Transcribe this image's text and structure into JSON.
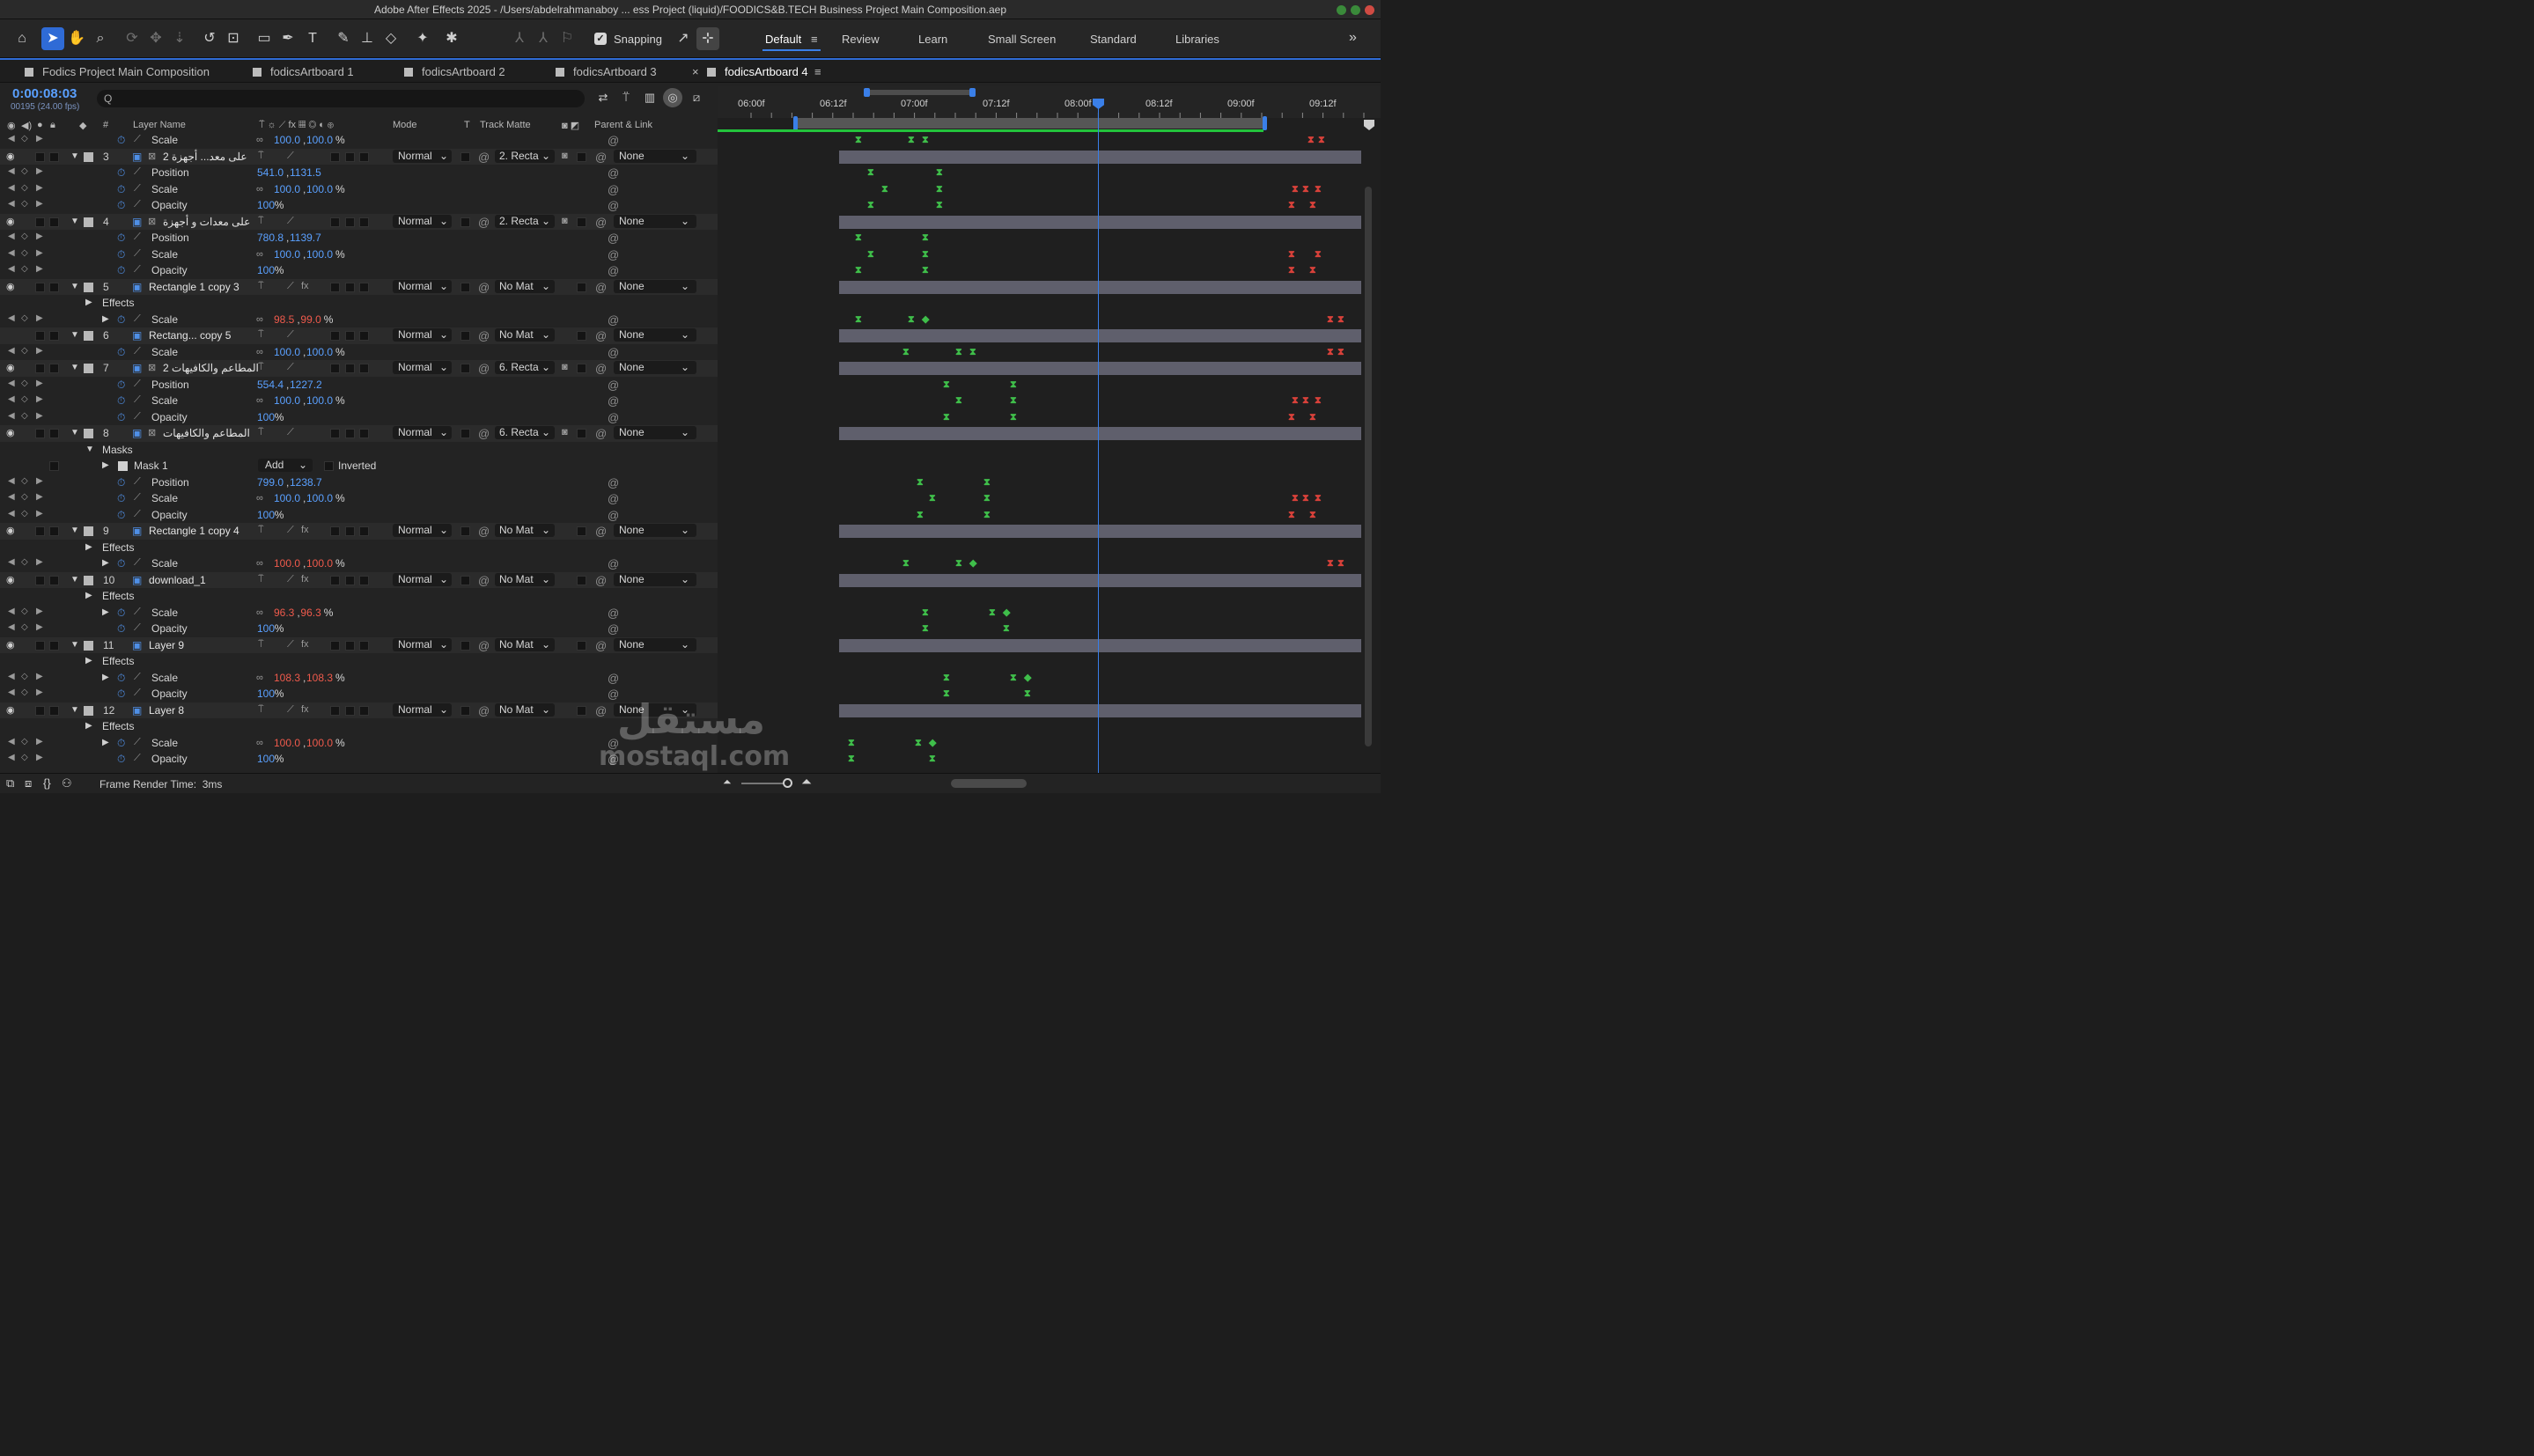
{
  "window": {
    "title": "Adobe After Effects 2025 - /Users/abdelrahmanaboy ... ess Project (liquid)/FOODICS&B.TECH Business Project Main Composition.aep"
  },
  "toolbar": {
    "snapping_label": "Snapping",
    "workspaces": [
      "Default",
      "Review",
      "Learn",
      "Small Screen",
      "Standard",
      "Libraries"
    ],
    "active_workspace": "Default",
    "more": "»"
  },
  "tabs": [
    {
      "label": "Fodics Project Main Composition",
      "active": false
    },
    {
      "label": "fodicsArtboard 1",
      "active": false
    },
    {
      "label": "fodicsArtboard 2",
      "active": false
    },
    {
      "label": "fodicsArtboard 3",
      "active": false
    },
    {
      "label": "fodicsArtboard 4",
      "active": true
    }
  ],
  "comp": {
    "timecode": "0:00:08:03",
    "frames_fps": "00195 (24.00 fps)",
    "search_placeholder": "Q"
  },
  "headers": {
    "num": "#",
    "layer_name": "Layer Name",
    "mode": "Mode",
    "t": "T",
    "track_matte": "Track Matte",
    "parent": "Parent & Link"
  },
  "ruler": {
    "labels": [
      "06:00f",
      "06:12f",
      "07:00f",
      "07:12f",
      "08:00f",
      "08:12f",
      "09:00f",
      "09:12f"
    ]
  },
  "rows": [
    {
      "type": "prop",
      "name": "Scale",
      "value": [
        "100.0",
        "100.0"
      ],
      "unit": "%",
      "link": true,
      "red": false,
      "kf": [
        [
          160,
          "g"
        ],
        [
          220,
          "g"
        ],
        [
          236,
          "g"
        ],
        [
          674,
          "r"
        ],
        [
          686,
          "r"
        ]
      ]
    },
    {
      "type": "layer",
      "num": "3",
      "name": "على معد... أجهزة 2",
      "mode": "Normal",
      "matte": "2. Recta",
      "parent": "None",
      "fx": false,
      "eye": true,
      "matte_icon": true
    },
    {
      "type": "prop",
      "name": "Position",
      "value": [
        "541.0",
        "1131.5"
      ],
      "unit": "",
      "link": false,
      "red": false,
      "kf": [
        [
          174,
          "g"
        ],
        [
          252,
          "g"
        ]
      ]
    },
    {
      "type": "prop",
      "name": "Scale",
      "value": [
        "100.0",
        "100.0"
      ],
      "unit": "%",
      "link": true,
      "red": false,
      "kf": [
        [
          190,
          "g"
        ],
        [
          252,
          "g"
        ],
        [
          656,
          "r"
        ],
        [
          668,
          "r"
        ],
        [
          682,
          "r"
        ]
      ]
    },
    {
      "type": "prop",
      "name": "Opacity",
      "value": [
        "100"
      ],
      "unit": "%",
      "link": false,
      "red": false,
      "kf": [
        [
          174,
          "g"
        ],
        [
          252,
          "g"
        ],
        [
          652,
          "r"
        ],
        [
          676,
          "r"
        ]
      ]
    },
    {
      "type": "layer",
      "num": "4",
      "name": "على معدات و أجهزة",
      "mode": "Normal",
      "matte": "2. Recta",
      "parent": "None",
      "fx": false,
      "eye": true,
      "matte_icon": true
    },
    {
      "type": "prop",
      "name": "Position",
      "value": [
        "780.8",
        "1139.7"
      ],
      "unit": "",
      "link": false,
      "red": false,
      "kf": [
        [
          160,
          "g"
        ],
        [
          236,
          "g"
        ]
      ]
    },
    {
      "type": "prop",
      "name": "Scale",
      "value": [
        "100.0",
        "100.0"
      ],
      "unit": "%",
      "link": true,
      "red": false,
      "kf": [
        [
          174,
          "g"
        ],
        [
          236,
          "g"
        ],
        [
          652,
          "r"
        ],
        [
          682,
          "r"
        ]
      ]
    },
    {
      "type": "prop",
      "name": "Opacity",
      "value": [
        "100"
      ],
      "unit": "%",
      "link": false,
      "red": false,
      "kf": [
        [
          160,
          "g"
        ],
        [
          236,
          "g"
        ],
        [
          652,
          "r"
        ],
        [
          676,
          "r"
        ]
      ]
    },
    {
      "type": "layer",
      "num": "5",
      "name": "Rectangle 1 copy 3",
      "mode": "Normal",
      "matte": "No Mat",
      "parent": "None",
      "fx": true,
      "eye": true,
      "matte_icon": false
    },
    {
      "type": "group",
      "name": "Effects",
      "indent": 116
    },
    {
      "type": "prop",
      "name": "Scale",
      "value": [
        "98.5",
        "99.0"
      ],
      "unit": "%",
      "link": true,
      "red": true,
      "twirl": true,
      "kf": [
        [
          160,
          "g"
        ],
        [
          220,
          "g"
        ],
        [
          236,
          "gd"
        ],
        [
          696,
          "r"
        ],
        [
          708,
          "r"
        ]
      ]
    },
    {
      "type": "layer",
      "num": "6",
      "name": "Rectang... copy 5",
      "mode": "Normal",
      "matte": "No Mat",
      "parent": "None",
      "fx": false,
      "eye": false,
      "matte_icon": false
    },
    {
      "type": "prop",
      "name": "Scale",
      "value": [
        "100.0",
        "100.0"
      ],
      "unit": "%",
      "link": true,
      "red": false,
      "kf": [
        [
          214,
          "g"
        ],
        [
          274,
          "g"
        ],
        [
          290,
          "g"
        ],
        [
          696,
          "r"
        ],
        [
          708,
          "r"
        ]
      ]
    },
    {
      "type": "layer",
      "num": "7",
      "name": "المطاعم والكافيهات 2",
      "mode": "Normal",
      "matte": "6. Recta",
      "parent": "None",
      "fx": false,
      "eye": true,
      "matte_icon": true
    },
    {
      "type": "prop",
      "name": "Position",
      "value": [
        "554.4",
        "1227.2"
      ],
      "unit": "",
      "link": false,
      "red": false,
      "kf": [
        [
          260,
          "g"
        ],
        [
          336,
          "g"
        ]
      ]
    },
    {
      "type": "prop",
      "name": "Scale",
      "value": [
        "100.0",
        "100.0"
      ],
      "unit": "%",
      "link": true,
      "red": false,
      "kf": [
        [
          274,
          "g"
        ],
        [
          336,
          "g"
        ],
        [
          656,
          "r"
        ],
        [
          668,
          "r"
        ],
        [
          682,
          "r"
        ]
      ]
    },
    {
      "type": "prop",
      "name": "Opacity",
      "value": [
        "100"
      ],
      "unit": "%",
      "link": false,
      "red": false,
      "kf": [
        [
          260,
          "g"
        ],
        [
          336,
          "g"
        ],
        [
          652,
          "r"
        ],
        [
          676,
          "r"
        ]
      ]
    },
    {
      "type": "layer",
      "num": "8",
      "name": "المطاعم والكافيهات",
      "mode": "Normal",
      "matte": "6. Recta",
      "parent": "None",
      "fx": false,
      "eye": true,
      "matte_icon": true
    },
    {
      "type": "group",
      "name": "Masks",
      "indent": 116,
      "open": true
    },
    {
      "type": "mask",
      "name": "Mask 1",
      "mode": "Add",
      "inverted": "Inverted"
    },
    {
      "type": "prop",
      "name": "Position",
      "value": [
        "799.0",
        "1238.7"
      ],
      "unit": "",
      "link": false,
      "red": false,
      "kf": [
        [
          230,
          "g"
        ],
        [
          306,
          "g"
        ]
      ]
    },
    {
      "type": "prop",
      "name": "Scale",
      "value": [
        "100.0",
        "100.0"
      ],
      "unit": "%",
      "link": true,
      "red": false,
      "kf": [
        [
          244,
          "g"
        ],
        [
          306,
          "g"
        ],
        [
          656,
          "r"
        ],
        [
          668,
          "r"
        ],
        [
          682,
          "r"
        ]
      ]
    },
    {
      "type": "prop",
      "name": "Opacity",
      "value": [
        "100"
      ],
      "unit": "%",
      "link": false,
      "red": false,
      "kf": [
        [
          230,
          "g"
        ],
        [
          306,
          "g"
        ],
        [
          652,
          "r"
        ],
        [
          676,
          "r"
        ]
      ]
    },
    {
      "type": "layer",
      "num": "9",
      "name": "Rectangle 1 copy 4",
      "mode": "Normal",
      "matte": "No Mat",
      "parent": "None",
      "fx": true,
      "eye": true,
      "matte_icon": false
    },
    {
      "type": "group",
      "name": "Effects",
      "indent": 116
    },
    {
      "type": "prop",
      "name": "Scale",
      "value": [
        "100.0",
        "100.0"
      ],
      "unit": "%",
      "link": true,
      "red": true,
      "twirl": true,
      "kf": [
        [
          214,
          "g"
        ],
        [
          274,
          "g"
        ],
        [
          290,
          "gd"
        ],
        [
          696,
          "r"
        ],
        [
          708,
          "r"
        ]
      ]
    },
    {
      "type": "layer",
      "num": "10",
      "name": "download_1",
      "mode": "Normal",
      "matte": "No Mat",
      "parent": "None",
      "fx": true,
      "eye": true,
      "matte_icon": false
    },
    {
      "type": "group",
      "name": "Effects",
      "indent": 116
    },
    {
      "type": "prop",
      "name": "Scale",
      "value": [
        "96.3",
        "96.3"
      ],
      "unit": "%",
      "link": true,
      "red": true,
      "twirl": true,
      "kf": [
        [
          236,
          "g"
        ],
        [
          312,
          "g"
        ],
        [
          328,
          "gd"
        ]
      ]
    },
    {
      "type": "prop",
      "name": "Opacity",
      "value": [
        "100"
      ],
      "unit": "%",
      "link": false,
      "red": false,
      "kf": [
        [
          236,
          "g"
        ],
        [
          328,
          "g"
        ]
      ]
    },
    {
      "type": "layer",
      "num": "11",
      "name": "Layer 9",
      "mode": "Normal",
      "matte": "No Mat",
      "parent": "None",
      "fx": true,
      "eye": true,
      "matte_icon": false
    },
    {
      "type": "group",
      "name": "Effects",
      "indent": 116
    },
    {
      "type": "prop",
      "name": "Scale",
      "value": [
        "108.3",
        "108.3"
      ],
      "unit": "%",
      "link": true,
      "red": true,
      "twirl": true,
      "kf": [
        [
          260,
          "g"
        ],
        [
          336,
          "g"
        ],
        [
          352,
          "gd"
        ]
      ]
    },
    {
      "type": "prop",
      "name": "Opacity",
      "value": [
        "100"
      ],
      "unit": "%",
      "link": false,
      "red": false,
      "kf": [
        [
          260,
          "g"
        ],
        [
          352,
          "g"
        ]
      ]
    },
    {
      "type": "layer",
      "num": "12",
      "name": "Layer 8",
      "mode": "Normal",
      "matte": "No Mat",
      "parent": "None",
      "fx": true,
      "eye": true,
      "matte_icon": false
    },
    {
      "type": "group",
      "name": "Effects",
      "indent": 116
    },
    {
      "type": "prop",
      "name": "Scale",
      "value": [
        "100.0",
        "100.0"
      ],
      "unit": "%",
      "link": true,
      "red": true,
      "twirl": true,
      "kf": [
        [
          152,
          "g"
        ],
        [
          228,
          "g"
        ],
        [
          244,
          "gd"
        ]
      ]
    },
    {
      "type": "prop",
      "name": "Opacity",
      "value": [
        "100"
      ],
      "unit": "%",
      "link": false,
      "red": false,
      "kf": [
        [
          152,
          "g"
        ],
        [
          244,
          "g"
        ]
      ]
    }
  ],
  "footer": {
    "frame_render_time": "Frame Render Time:",
    "frame_render_value": "3ms"
  },
  "watermark": {
    "arabic": "مستقل",
    "latin": "mostaql.com"
  },
  "colors": {
    "accent": "#2f6bd6",
    "value_blue": "#5aa0ff",
    "value_red": "#ef5a4c",
    "keyframe_green": "#3fbe4a",
    "keyframe_red": "#d8413a",
    "layer_bar": "#5f5f6c"
  }
}
